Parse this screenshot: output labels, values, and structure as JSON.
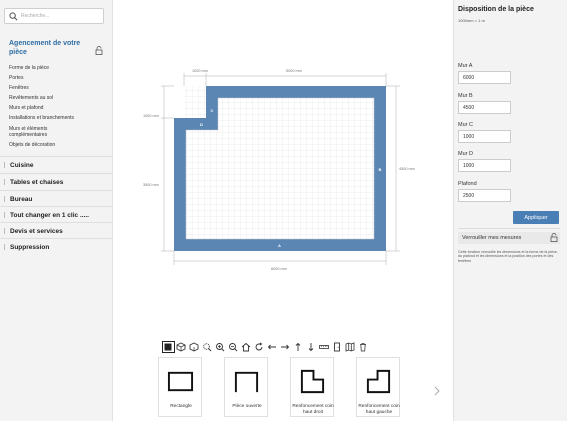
{
  "search": {
    "placeholder": "Recherche..."
  },
  "sidebar": {
    "section_title": "Agencement de votre pièce",
    "subitems": [
      "Forme de la pièce",
      "Portes",
      "Fenêtres",
      "Revêtements au sol",
      "Murs et plafond",
      "Installations et branchements",
      "Murs et éléments complémentaires",
      "Objets de décoration"
    ],
    "categories": [
      "Cuisine",
      "Tables et chaises",
      "Bureau",
      "Tout changer en 1 clic .....",
      "Devis et services",
      "Suppression"
    ]
  },
  "panel": {
    "title": "Disposition de la pièce",
    "scale": "1000mm = 1 m",
    "fields": [
      {
        "label": "Mur A",
        "value": "6000"
      },
      {
        "label": "Mur B",
        "value": "4500"
      },
      {
        "label": "Mur C",
        "value": "1000"
      },
      {
        "label": "Mur D",
        "value": "1000"
      },
      {
        "label": "Plafond",
        "value": "2500"
      }
    ],
    "apply_label": "Appliquer",
    "lock_label": "Verrouiller mes mesures",
    "note": "Cette fonction verrouille les dimensions et la forme de la pièce, du plafond et les dimensions et la position des portes et des fenêtres"
  },
  "plan": {
    "dims": {
      "top_left": "1000 mm",
      "top_right": "5000 mm",
      "left_top": "1000 mm",
      "left_bottom": "3500 mm",
      "right": "4500 mm",
      "bottom": "6000 mm"
    },
    "wall_labels": {
      "c": "C",
      "d": "D",
      "b": "B",
      "a": "A"
    },
    "wall_color": "#5b86b3"
  },
  "toolbar": {
    "tools": [
      "select-icon",
      "view-2d-icon",
      "view-3d-icon",
      "zoom-fit-icon",
      "zoom-in-icon",
      "zoom-out-icon",
      "home-icon",
      "rotate-icon",
      "arrow-left-icon",
      "arrow-right-icon",
      "arrow-up-icon",
      "arrow-down-icon",
      "ruler-icon",
      "door-icon",
      "map-icon",
      "trash-icon"
    ]
  },
  "shapes": [
    {
      "label": "Rectangle"
    },
    {
      "label": "Pièce ouverte"
    },
    {
      "label": "Renfoncement coin haut droit"
    },
    {
      "label": "Renfoncement coin haut gauche"
    }
  ]
}
